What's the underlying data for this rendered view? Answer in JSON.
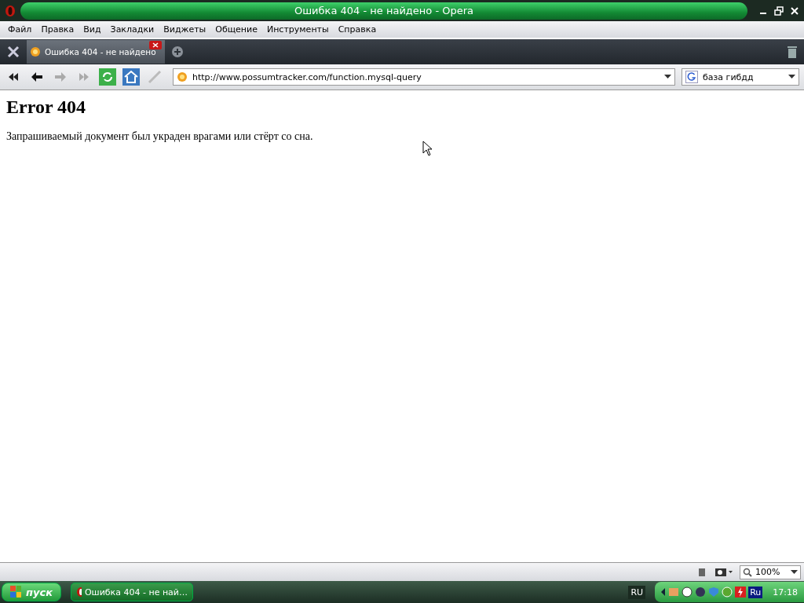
{
  "window": {
    "title": "Ошибка 404 - не найдено - Opera"
  },
  "menu": [
    "Файл",
    "Правка",
    "Вид",
    "Закладки",
    "Виджеты",
    "Общение",
    "Инструменты",
    "Справка"
  ],
  "tabs": [
    {
      "title": "Ошибка 404 - не найдено",
      "selected": true
    }
  ],
  "address": {
    "value": "http://www.possumtracker.com/function.mysql-query"
  },
  "search": {
    "value": "база гибдд"
  },
  "page": {
    "heading": "Error 404",
    "text": "Запрашиваемый документ был украден врагами или стёрт со сна."
  },
  "status_bar": {
    "zoom": "100%"
  },
  "taskbar": {
    "start": "пуск",
    "tasks": [
      {
        "title": "Ошибка 404 - не най…",
        "selected": true
      }
    ],
    "language": "RU",
    "tray_language": "Ru",
    "clock": "17:18"
  }
}
